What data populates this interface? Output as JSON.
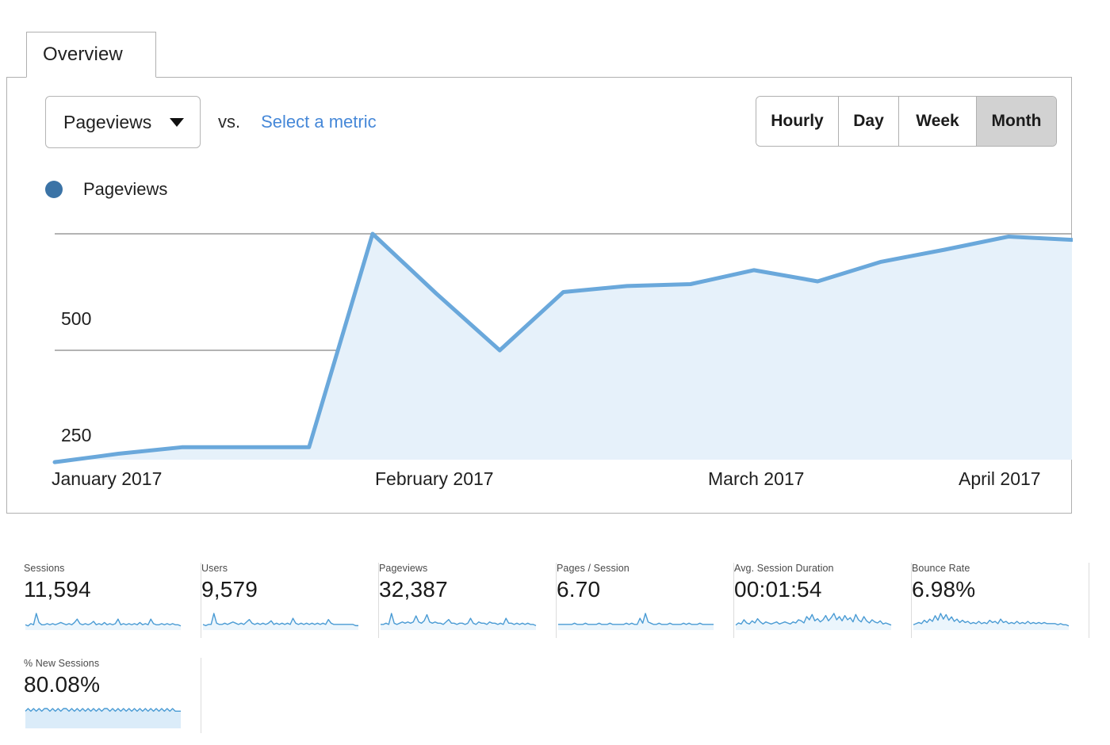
{
  "tab": {
    "label": "Overview"
  },
  "controls": {
    "metric_select": {
      "value": "Pageviews",
      "caret_icon": "chevron-down-icon"
    },
    "vs_label": "vs.",
    "select_metric_link": "Select a metric",
    "range_buttons": [
      {
        "label": "Hourly",
        "selected": false
      },
      {
        "label": "Day",
        "selected": false
      },
      {
        "label": "Week",
        "selected": false
      },
      {
        "label": "Month",
        "selected": true
      }
    ]
  },
  "legend": {
    "series_label": "Pageviews",
    "dot_color": "#3b73a6"
  },
  "colors": {
    "line": "#6aa8db",
    "area_fill": "#e6f1fa",
    "gridline": "#9a9a9a",
    "link": "#4688d8",
    "selected_button_bg": "#d2d2d2",
    "sparkline": "#4a9bd4",
    "sparkline_fill": "#dbecf9"
  },
  "chart_data": {
    "type": "area",
    "title": "",
    "xlabel": "",
    "ylabel": "",
    "ylim": [
      0,
      560
    ],
    "yticks": [
      250,
      500
    ],
    "ytick_labels": [
      "250",
      "500"
    ],
    "grid": true,
    "legend_position": "top-left",
    "x_tick_labels": [
      "January 2017",
      "February 2017",
      "March 2017",
      "April 2017"
    ],
    "series": [
      {
        "name": "Pageviews",
        "x": [
          0,
          1,
          2,
          3,
          4,
          5,
          6,
          7,
          8,
          9,
          10,
          11,
          12,
          13,
          14,
          15
        ],
        "values": [
          10,
          28,
          42,
          42,
          42,
          500,
          372,
          250,
          375,
          388,
          392,
          422,
          398,
          440,
          466,
          494,
          487
        ]
      }
    ]
  },
  "cards": [
    {
      "title": "Sessions",
      "value": "11,594",
      "sparkline": [
        4,
        3,
        5,
        4,
        14,
        6,
        4,
        4,
        5,
        4,
        5,
        4,
        5,
        6,
        5,
        4,
        5,
        4,
        6,
        9,
        5,
        4,
        5,
        4,
        5,
        7,
        4,
        5,
        4,
        6,
        4,
        5,
        4,
        5,
        9,
        4,
        5,
        4,
        5,
        4,
        5,
        4,
        6,
        4,
        5,
        4,
        9,
        5,
        4,
        4,
        5,
        4,
        5,
        4,
        5,
        4,
        4,
        3
      ],
      "filled": false
    },
    {
      "title": "Users",
      "value": "9,579",
      "sparkline": [
        4,
        3,
        4,
        4,
        13,
        5,
        4,
        4,
        5,
        4,
        5,
        6,
        5,
        4,
        5,
        4,
        6,
        8,
        5,
        4,
        5,
        4,
        5,
        4,
        5,
        7,
        4,
        5,
        4,
        5,
        4,
        5,
        4,
        9,
        5,
        4,
        5,
        4,
        5,
        4,
        5,
        4,
        5,
        4,
        5,
        4,
        8,
        5,
        4,
        4,
        4,
        4,
        4,
        4,
        4,
        4,
        3,
        3
      ],
      "filled": false
    },
    {
      "title": "Pageviews",
      "value": "32,387",
      "sparkline": [
        4,
        4,
        5,
        4,
        13,
        5,
        4,
        5,
        6,
        5,
        6,
        5,
        6,
        11,
        6,
        5,
        7,
        12,
        6,
        5,
        6,
        5,
        5,
        4,
        6,
        8,
        5,
        5,
        4,
        5,
        5,
        4,
        5,
        9,
        5,
        4,
        6,
        5,
        5,
        4,
        6,
        5,
        5,
        4,
        5,
        4,
        9,
        5,
        5,
        4,
        5,
        4,
        5,
        4,
        5,
        4,
        4,
        3
      ],
      "filled": false
    },
    {
      "title": "Pages / Session",
      "value": "6.70",
      "sparkline": [
        4,
        4,
        4,
        4,
        4,
        4,
        5,
        4,
        4,
        4,
        5,
        4,
        4,
        4,
        4,
        5,
        4,
        4,
        4,
        5,
        4,
        4,
        4,
        4,
        4,
        5,
        4,
        5,
        4,
        4,
        9,
        5,
        13,
        6,
        5,
        4,
        4,
        5,
        4,
        4,
        4,
        5,
        4,
        4,
        4,
        4,
        5,
        4,
        5,
        4,
        4,
        4,
        5,
        4,
        4,
        4,
        4,
        4
      ],
      "filled": false
    },
    {
      "title": "Avg. Session Duration",
      "value": "00:01:54",
      "sparkline": [
        4,
        6,
        5,
        9,
        6,
        5,
        8,
        6,
        10,
        7,
        5,
        7,
        6,
        5,
        6,
        7,
        5,
        6,
        7,
        6,
        5,
        7,
        6,
        9,
        8,
        6,
        12,
        9,
        14,
        8,
        10,
        7,
        9,
        13,
        8,
        11,
        15,
        9,
        12,
        8,
        13,
        9,
        11,
        7,
        14,
        9,
        7,
        12,
        8,
        6,
        9,
        7,
        6,
        8,
        5,
        6,
        5,
        4
      ],
      "filled": false
    },
    {
      "title": "Bounce Rate",
      "value": "6.98%",
      "sparkline": [
        4,
        5,
        6,
        5,
        8,
        6,
        9,
        7,
        12,
        8,
        14,
        9,
        13,
        8,
        11,
        7,
        9,
        6,
        8,
        6,
        7,
        5,
        6,
        5,
        7,
        5,
        6,
        5,
        8,
        6,
        7,
        5,
        9,
        6,
        7,
        5,
        6,
        5,
        7,
        5,
        6,
        5,
        7,
        5,
        6,
        5,
        6,
        5,
        6,
        5,
        5,
        5,
        5,
        4,
        5,
        4,
        4,
        3
      ],
      "filled": false
    },
    {
      "title": "% New Sessions",
      "value": "80.08%",
      "sparkline": [
        5,
        6,
        5,
        6,
        5,
        6,
        5,
        6,
        6,
        5,
        6,
        5,
        6,
        5,
        6,
        6,
        5,
        6,
        5,
        6,
        5,
        6,
        5,
        6,
        5,
        6,
        5,
        6,
        5,
        6,
        6,
        5,
        6,
        5,
        6,
        5,
        6,
        5,
        6,
        5,
        6,
        5,
        6,
        5,
        6,
        5,
        6,
        5,
        6,
        5,
        6,
        5,
        6,
        5,
        6,
        5,
        5,
        5
      ],
      "filled": true
    }
  ]
}
